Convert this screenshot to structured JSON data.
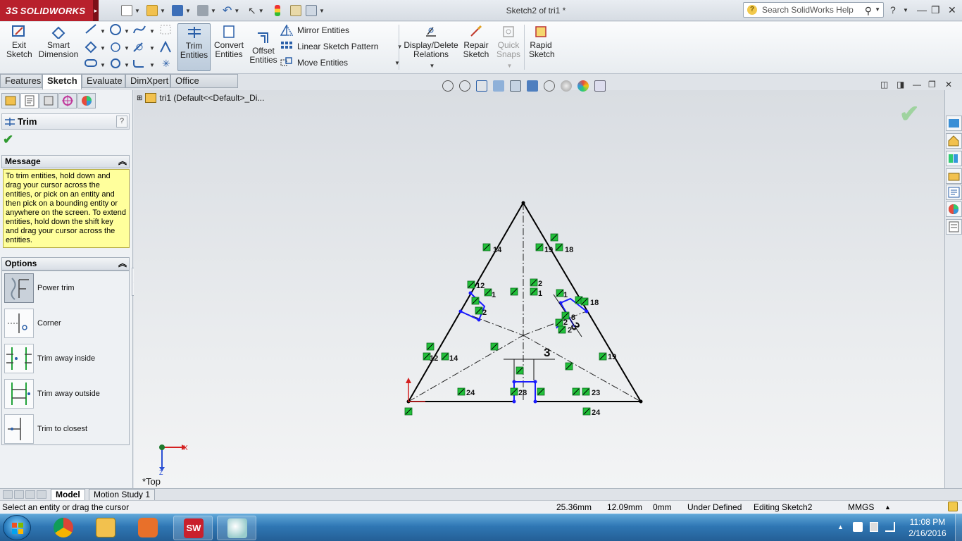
{
  "titlebar": {
    "logo_prefix": "3S",
    "logo_text": "SOLIDWORKS",
    "document_title": "Sketch2 of tri1 *",
    "help_search_placeholder": "Search SolidWorks Help"
  },
  "command_manager": {
    "exit_sketch": "Exit Sketch",
    "smart_dimension": "Smart Dimension",
    "trim_entities": "Trim Entities",
    "convert_entities": "Convert Entities",
    "offset_entities": "Offset Entities",
    "mirror_entities": "Mirror Entities",
    "linear_sketch_pattern": "Linear Sketch Pattern",
    "move_entities": "Move Entities",
    "display_delete_relations": "Display/Delete Relations",
    "repair_sketch": "Repair Sketch",
    "quick_snaps": "Quick Snaps",
    "rapid_sketch": "Rapid Sketch"
  },
  "tabs": [
    "Features",
    "Sketch",
    "Evaluate",
    "DimXpert",
    "Office Products"
  ],
  "active_tab": "Sketch",
  "property_manager": {
    "title": "Trim",
    "help_glyph": "?",
    "message_header": "Message",
    "message_text": "To trim entities, hold down and drag your cursor across the entities, or pick on an entity and then pick on a bounding entity or anywhere on the screen.  To extend entities, hold down the shift key and drag your cursor across the entities.",
    "options_header": "Options",
    "options": [
      "Power trim",
      "Corner",
      "Trim away inside",
      "Trim away outside",
      "Trim to closest"
    ],
    "selected_option": "Power trim"
  },
  "graphics": {
    "tree_item": "tri1  (Default<<Default>_Di...",
    "view_label": "*Top",
    "triad_x": "X",
    "triad_z": "Z",
    "dimension_labels": [
      "3",
      "3"
    ],
    "relation_labels": [
      "14",
      "19",
      "18",
      "12",
      "1",
      "2",
      "1",
      "2",
      "1",
      "18",
      "8",
      "2",
      "2",
      "12",
      "14",
      "19",
      "24",
      "28",
      "23",
      "24"
    ]
  },
  "bottom_tabs": [
    "Model",
    "Motion Study 1"
  ],
  "statusbar": {
    "message": "Select an entity or drag the cursor",
    "x": "25.36mm",
    "y": "12.09mm",
    "z": "0mm",
    "state": "Under Defined",
    "editing": "Editing Sketch2",
    "units": "MMGS"
  },
  "taskbar": {
    "time": "11:08 PM",
    "date": "2/16/2016"
  },
  "colors": {
    "logo_red": "#b8202c",
    "message_yellow": "#ffff9c",
    "relation_green": "#22c03a",
    "sketch_blue": "#1a1aff"
  }
}
